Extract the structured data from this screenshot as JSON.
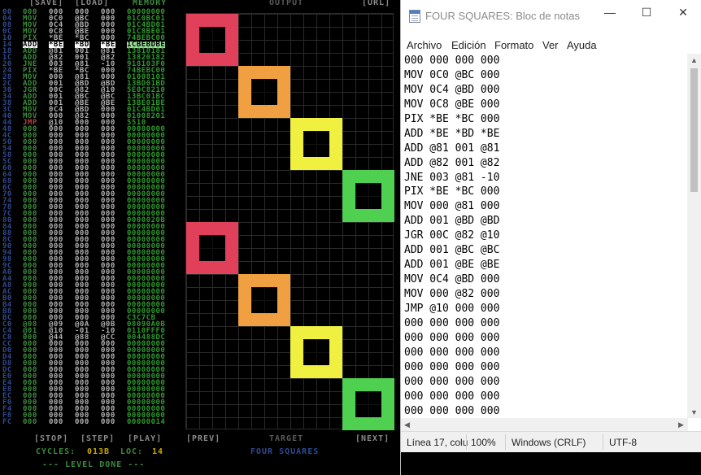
{
  "game": {
    "buttons": {
      "save": "[SAVE]",
      "load": "[LOAD]",
      "memory": "MEMORY",
      "output": "OUTPUT",
      "url": "[URL]"
    },
    "code_rows": [
      {
        "addr": "00",
        "op": "000",
        "a1": "000",
        "a2": "000",
        "a3": "000",
        "mem": "00000000"
      },
      {
        "addr": "04",
        "op": "MOV",
        "a1": "0C0",
        "a2": "@BC",
        "a3": "000",
        "mem": "01C0BC01"
      },
      {
        "addr": "08",
        "op": "MOV",
        "a1": "0C4",
        "a2": "@BD",
        "a3": "000",
        "mem": "01C4BD01"
      },
      {
        "addr": "0C",
        "op": "MOV",
        "a1": "0C8",
        "a2": "@BE",
        "a3": "000",
        "mem": "01C8BE01"
      },
      {
        "addr": "10",
        "op": "PIX",
        "a1": "*BE",
        "a2": "*BC",
        "a3": "000",
        "mem": "74BEBC00"
      },
      {
        "addr": "14",
        "op": "ADD",
        "a1": "*BE",
        "a2": "*BD",
        "a3": "*BE",
        "mem": "1CBEBDBE"
      },
      {
        "addr": "18",
        "op": "ADD",
        "a1": "@81",
        "a2": "001",
        "a3": "@81",
        "mem": "13810181"
      },
      {
        "addr": "1C",
        "op": "ADD",
        "a1": "@82",
        "a2": "001",
        "a3": "@82",
        "mem": "13820182"
      },
      {
        "addr": "20",
        "op": "JNE",
        "a1": "003",
        "a2": "@81",
        "a3": "-10",
        "mem": "918103F0"
      },
      {
        "addr": "24",
        "op": "PIX",
        "a1": "*BE",
        "a2": "*BC",
        "a3": "000",
        "mem": "74BEBC00"
      },
      {
        "addr": "28",
        "op": "MOV",
        "a1": "000",
        "a2": "@81",
        "a3": "000",
        "mem": "01008101"
      },
      {
        "addr": "2C",
        "op": "ADD",
        "a1": "001",
        "a2": "@BD",
        "a3": "@BD",
        "mem": "13BD01BD"
      },
      {
        "addr": "30",
        "op": "JGR",
        "a1": "00C",
        "a2": "@82",
        "a3": "@10",
        "mem": "5E0C8210"
      },
      {
        "addr": "34",
        "op": "ADD",
        "a1": "001",
        "a2": "@BC",
        "a3": "@BC",
        "mem": "13BC01BC"
      },
      {
        "addr": "38",
        "op": "ADD",
        "a1": "001",
        "a2": "@BE",
        "a3": "@BE",
        "mem": "13BE01BE"
      },
      {
        "addr": "3C",
        "op": "MOV",
        "a1": "0C4",
        "a2": "@BD",
        "a3": "000",
        "mem": "01C4BD01"
      },
      {
        "addr": "40",
        "op": "MOV",
        "a1": "000",
        "a2": "@82",
        "a3": "000",
        "mem": "01008201"
      },
      {
        "addr": "44",
        "op": "JMP",
        "a1": "@10",
        "a2": "000",
        "a3": "000",
        "mem": "5510"
      },
      {
        "addr": "48",
        "op": "000",
        "a1": "000",
        "a2": "000",
        "a3": "000",
        "mem": "00000000"
      },
      {
        "addr": "4C",
        "op": "000",
        "a1": "000",
        "a2": "000",
        "a3": "000",
        "mem": "00000000"
      },
      {
        "addr": "50",
        "op": "000",
        "a1": "000",
        "a2": "000",
        "a3": "000",
        "mem": "00000000"
      },
      {
        "addr": "54",
        "op": "000",
        "a1": "000",
        "a2": "000",
        "a3": "000",
        "mem": "00000000"
      },
      {
        "addr": "58",
        "op": "000",
        "a1": "000",
        "a2": "000",
        "a3": "000",
        "mem": "00000000"
      },
      {
        "addr": "5C",
        "op": "000",
        "a1": "000",
        "a2": "000",
        "a3": "000",
        "mem": "00000000"
      },
      {
        "addr": "60",
        "op": "000",
        "a1": "000",
        "a2": "000",
        "a3": "000",
        "mem": "00000000"
      },
      {
        "addr": "64",
        "op": "000",
        "a1": "000",
        "a2": "000",
        "a3": "000",
        "mem": "00000000"
      },
      {
        "addr": "68",
        "op": "000",
        "a1": "000",
        "a2": "000",
        "a3": "000",
        "mem": "00000000"
      },
      {
        "addr": "6C",
        "op": "000",
        "a1": "000",
        "a2": "000",
        "a3": "000",
        "mem": "00000000"
      },
      {
        "addr": "70",
        "op": "000",
        "a1": "000",
        "a2": "000",
        "a3": "000",
        "mem": "00000000"
      },
      {
        "addr": "74",
        "op": "000",
        "a1": "000",
        "a2": "000",
        "a3": "000",
        "mem": "00000000"
      },
      {
        "addr": "78",
        "op": "000",
        "a1": "000",
        "a2": "000",
        "a3": "000",
        "mem": "00000000"
      },
      {
        "addr": "7C",
        "op": "000",
        "a1": "000",
        "a2": "000",
        "a3": "000",
        "mem": "00000000"
      },
      {
        "addr": "80",
        "op": "000",
        "a1": "000",
        "a2": "000",
        "a3": "000",
        "mem": "0000020B"
      },
      {
        "addr": "84",
        "op": "000",
        "a1": "000",
        "a2": "000",
        "a3": "000",
        "mem": "00000000"
      },
      {
        "addr": "88",
        "op": "000",
        "a1": "000",
        "a2": "000",
        "a3": "000",
        "mem": "00000000"
      },
      {
        "addr": "8C",
        "op": "000",
        "a1": "000",
        "a2": "000",
        "a3": "000",
        "mem": "00000000"
      },
      {
        "addr": "90",
        "op": "000",
        "a1": "000",
        "a2": "000",
        "a3": "000",
        "mem": "00000000"
      },
      {
        "addr": "94",
        "op": "000",
        "a1": "000",
        "a2": "000",
        "a3": "000",
        "mem": "00000000"
      },
      {
        "addr": "98",
        "op": "000",
        "a1": "000",
        "a2": "000",
        "a3": "000",
        "mem": "00000000"
      },
      {
        "addr": "9C",
        "op": "000",
        "a1": "000",
        "a2": "000",
        "a3": "000",
        "mem": "00000000"
      },
      {
        "addr": "A0",
        "op": "000",
        "a1": "000",
        "a2": "000",
        "a3": "000",
        "mem": "00000000"
      },
      {
        "addr": "A4",
        "op": "000",
        "a1": "000",
        "a2": "000",
        "a3": "000",
        "mem": "00000000"
      },
      {
        "addr": "A8",
        "op": "000",
        "a1": "000",
        "a2": "000",
        "a3": "000",
        "mem": "00000000"
      },
      {
        "addr": "AC",
        "op": "000",
        "a1": "000",
        "a2": "000",
        "a3": "000",
        "mem": "00000000"
      },
      {
        "addr": "B0",
        "op": "000",
        "a1": "000",
        "a2": "000",
        "a3": "000",
        "mem": "00000000"
      },
      {
        "addr": "B4",
        "op": "000",
        "a1": "000",
        "a2": "000",
        "a3": "000",
        "mem": "00000000"
      },
      {
        "addr": "B8",
        "op": "000",
        "a1": "000",
        "a2": "000",
        "a3": "000",
        "mem": "00000000"
      },
      {
        "addr": "BC",
        "op": "000",
        "a1": "000",
        "a2": "000",
        "a3": "000",
        "mem": "C3C7CB"
      },
      {
        "addr": "C0",
        "op": "@08",
        "a1": "@09",
        "a2": "@0A",
        "a3": "@0B",
        "mem": "08090A0B"
      },
      {
        "addr": "C4",
        "op": "@01",
        "a1": "@10",
        "a2": "-01",
        "a3": "-10",
        "mem": "0110FFF0"
      },
      {
        "addr": "C8",
        "op": "000",
        "a1": "@44",
        "a2": "@88",
        "a3": "@CC",
        "mem": "004488DC"
      },
      {
        "addr": "CC",
        "op": "000",
        "a1": "000",
        "a2": "000",
        "a3": "000",
        "mem": "00000000"
      },
      {
        "addr": "D0",
        "op": "000",
        "a1": "000",
        "a2": "000",
        "a3": "000",
        "mem": "00000000"
      },
      {
        "addr": "D4",
        "op": "000",
        "a1": "000",
        "a2": "000",
        "a3": "000",
        "mem": "00000000"
      },
      {
        "addr": "D8",
        "op": "000",
        "a1": "000",
        "a2": "000",
        "a3": "000",
        "mem": "00000000"
      },
      {
        "addr": "DC",
        "op": "000",
        "a1": "000",
        "a2": "000",
        "a3": "000",
        "mem": "00000000"
      },
      {
        "addr": "E0",
        "op": "000",
        "a1": "000",
        "a2": "000",
        "a3": "000",
        "mem": "00000000"
      },
      {
        "addr": "E4",
        "op": "000",
        "a1": "000",
        "a2": "000",
        "a3": "000",
        "mem": "00000000"
      },
      {
        "addr": "E8",
        "op": "000",
        "a1": "000",
        "a2": "000",
        "a3": "000",
        "mem": "00000000"
      },
      {
        "addr": "EC",
        "op": "000",
        "a1": "000",
        "a2": "000",
        "a3": "000",
        "mem": "00000000"
      },
      {
        "addr": "F0",
        "op": "000",
        "a1": "000",
        "a2": "000",
        "a3": "000",
        "mem": "00000000"
      },
      {
        "addr": "F4",
        "op": "000",
        "a1": "000",
        "a2": "000",
        "a3": "000",
        "mem": "00000000"
      },
      {
        "addr": "F8",
        "op": "000",
        "a1": "000",
        "a2": "000",
        "a3": "000",
        "mem": "00000000"
      },
      {
        "addr": "FC",
        "op": "000",
        "a1": "000",
        "a2": "000",
        "a3": "000",
        "mem": "00000014"
      }
    ],
    "highlight_row": 5,
    "jump_row": 17,
    "output_colors": [
      "#e0405a",
      "#f0a040",
      "#f0f040",
      "#50d050"
    ],
    "controls": {
      "stop": "[STOP]",
      "step": "[STEP]",
      "play": "[PLAY]",
      "prev": "[PREV]",
      "target": "TARGET",
      "next": "[NEXT]"
    },
    "stats": {
      "cycles_label": "CYCLES:",
      "cycles": "013B",
      "loc_label": "LOC:",
      "loc": "14"
    },
    "level_name": "FOUR SQUARES",
    "status": "--- LEVEL DONE ---"
  },
  "notepad": {
    "title": "FOUR SQUARES: Bloc de notas",
    "window_controls": {
      "minimize": "—",
      "maximize": "☐",
      "close": "✕"
    },
    "menu": [
      "Archivo",
      "Edición",
      "Formato",
      "Ver",
      "Ayuda"
    ],
    "lines": [
      "000 000 000 000",
      "MOV 0C0 @BC 000",
      "MOV 0C4 @BD 000",
      "MOV 0C8 @BE 000",
      "PIX *BE *BC 000",
      "ADD *BE *BD *BE",
      "ADD @81 001 @81",
      "ADD @82 001 @82",
      "JNE 003 @81 -10",
      "PIX *BE *BC 000",
      "MOV 000 @81 000",
      "ADD 001 @BD @BD",
      "JGR 00C @82 @10",
      "ADD 001 @BC @BC",
      "ADD 001 @BE @BE",
      "MOV 0C4 @BD 000",
      "MOV 000 @82 000",
      "JMP @10 000 000",
      "000 000 000 000",
      "000 000 000 000",
      "000 000 000 000",
      "000 000 000 000",
      "000 000 000 000",
      "000 000 000 000",
      "000 000 000 000"
    ],
    "status": {
      "position": "Línea 17, colu",
      "zoom": "100%",
      "line_endings": "Windows (CRLF)",
      "encoding": "UTF-8"
    }
  }
}
